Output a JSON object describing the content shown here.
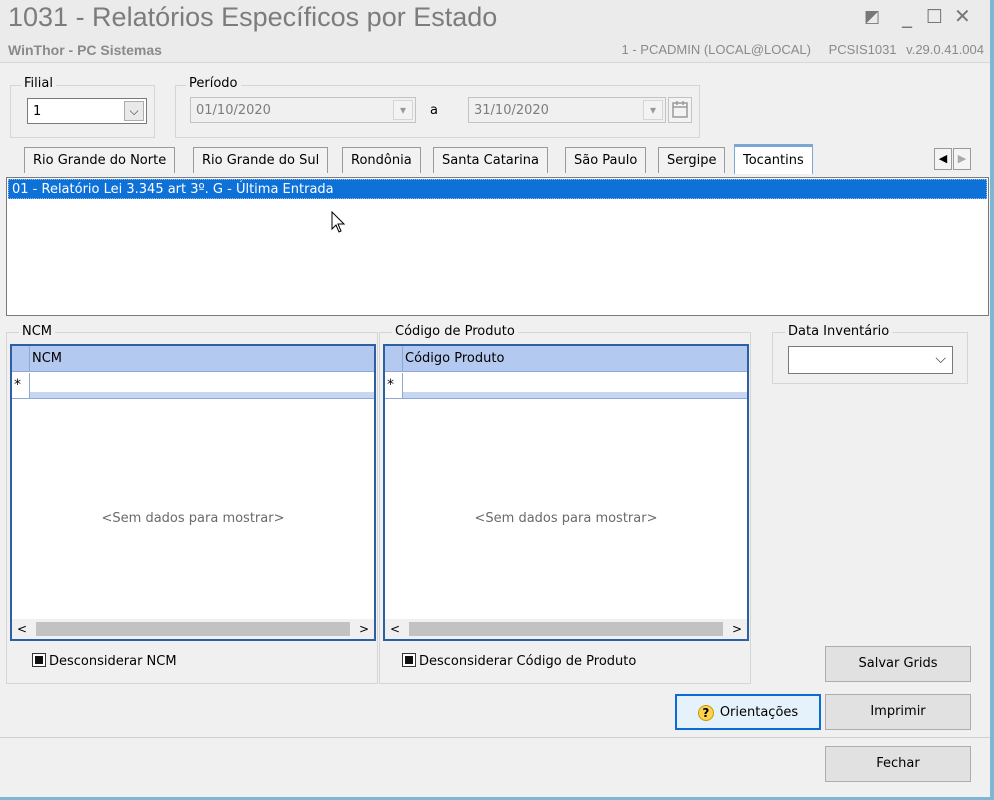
{
  "window": {
    "title": "1031 - Relatórios Específicos por Estado",
    "subtitle": "WinThor - PC Sistemas",
    "user": "1 - PCADMIN (LOCAL@LOCAL)",
    "program": "PCSIS1031",
    "version": "v.29.0.41.004",
    "controls": {
      "restore": "◩",
      "minimize": "_",
      "maximize": "☐",
      "close": "✕"
    }
  },
  "filial": {
    "label": "Filial",
    "value": "1"
  },
  "periodo": {
    "label": "Período",
    "start": "01/10/2020",
    "separator": "a",
    "end": "31/10/2020"
  },
  "tabs": [
    {
      "label": "Rio Grande do Norte"
    },
    {
      "label": "Rio Grande do Sul"
    },
    {
      "label": "Rondônia"
    },
    {
      "label": "Santa Catarina"
    },
    {
      "label": "São Paulo"
    },
    {
      "label": "Sergipe"
    },
    {
      "label": "Tocantins",
      "active": true
    }
  ],
  "tab_nav": {
    "prev": "◀",
    "next": "▶"
  },
  "reports": [
    {
      "label": "01 - Relatório Lei 3.345 art 3º. G - Última Entrada",
      "selected": true
    }
  ],
  "ncm": {
    "group_label": "NCM",
    "column": "NCM",
    "new_row_marker": "*",
    "empty": "<Sem dados para mostrar>",
    "checkbox": "Desconsiderar NCM"
  },
  "codigo": {
    "group_label": "Código de Produto",
    "column": "Código Produto",
    "new_row_marker": "*",
    "empty": "<Sem dados para mostrar>",
    "checkbox": "Desconsiderar Código de Produto"
  },
  "data_inventario": {
    "label": "Data Inventário",
    "value": ""
  },
  "scroll": {
    "left": "<",
    "right": ">"
  },
  "buttons": {
    "salvar_grids": "Salvar Grids",
    "orientacoes": "Orientações",
    "imprimir": "Imprimir",
    "fechar": "Fechar"
  }
}
